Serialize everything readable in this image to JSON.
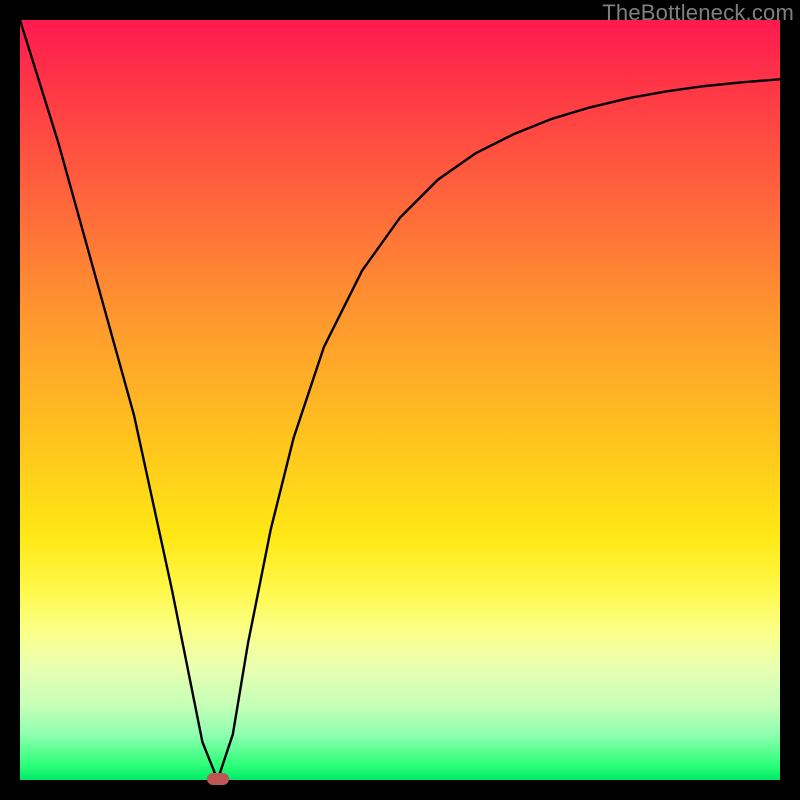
{
  "watermark": "TheBottleneck.com",
  "colors": {
    "frame": "#000000",
    "gradient_top": "#ff1a50",
    "gradient_bottom": "#00e86a",
    "curve": "#000000",
    "marker": "#c05555",
    "watermark": "#808080"
  },
  "chart_data": {
    "type": "line",
    "title": "",
    "xlabel": "",
    "ylabel": "",
    "xlim": [
      0,
      100
    ],
    "ylim": [
      0,
      100
    ],
    "annotations": [
      {
        "text": "TheBottleneck.com",
        "position": "top-right"
      }
    ],
    "marker": {
      "x": 26,
      "y_bottleneck_pct": 0
    },
    "series": [
      {
        "name": "bottleneck-curve",
        "x": [
          0,
          5,
          10,
          15,
          20,
          24,
          26,
          28,
          30,
          33,
          36,
          40,
          45,
          50,
          55,
          60,
          65,
          70,
          75,
          80,
          85,
          90,
          95,
          100
        ],
        "y_bottleneck_pct": [
          100,
          84,
          66,
          48,
          25,
          5,
          0,
          6,
          18,
          33,
          45,
          57,
          67,
          74,
          79,
          82.5,
          85,
          87,
          88.5,
          89.7,
          90.6,
          91.3,
          91.8,
          92.2
        ]
      }
    ],
    "description": "V-shaped bottleneck curve over a red-to-green vertical gradient. Minimum (0%) near x≈26 marked with a small rounded indicator at the bottom. Left branch is steep and nearly linear from 100% at x=0 down to 0% at x≈26. Right branch rises with decreasing slope toward ~92% at x=100."
  }
}
